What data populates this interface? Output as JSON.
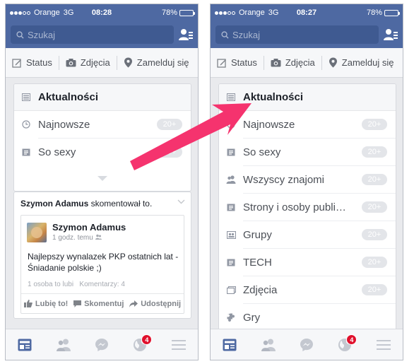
{
  "colors": {
    "header_blue": "#4e69a2",
    "badge_gray": "#e3e5e9",
    "arrow_pink": "#f5336e",
    "notification_red": "#e0102c"
  },
  "left": {
    "status": {
      "carrier": "Orange",
      "network": "3G",
      "time": "08:28",
      "battery": "78%",
      "battery_level": 0.78
    },
    "search": {
      "placeholder": "Szukaj",
      "icon": "search-icon"
    },
    "publisher": {
      "status": "Status",
      "photos": "Zdjęcia",
      "checkin": "Zamelduj się"
    },
    "menu": {
      "header": "Aktualności",
      "items": [
        {
          "label": "Najnowsze",
          "icon": "clock-icon",
          "badge": "20+"
        },
        {
          "label": "So sexy",
          "icon": "list-icon",
          "badge": "20+"
        }
      ]
    },
    "story": {
      "actor": "Szymon Adamus",
      "action": " skomentował to.",
      "post_author": "Szymon Adamus",
      "post_time": "1 godz. temu",
      "post_text": "Najlepszy wynalazek PKP ostatnich lat - Śniadanie polskie ;)",
      "likes": "1 osoba to lubi",
      "comments": "Komentarzy: 4",
      "like_btn": "Lubię to!",
      "comment_btn": "Skomentuj",
      "share_btn": "Udostępnij"
    },
    "tabs": {
      "notifications_badge": "4"
    }
  },
  "right": {
    "status": {
      "carrier": "Orange",
      "network": "3G",
      "time": "08:27",
      "battery": "78%",
      "battery_level": 0.78
    },
    "search": {
      "placeholder": "Szukaj",
      "icon": "search-icon"
    },
    "publisher": {
      "status": "Status",
      "photos": "Zdjęcia",
      "checkin": "Zamelduj się"
    },
    "menu": {
      "header": "Aktualności",
      "items": [
        {
          "label": "Najnowsze",
          "icon": "clock-icon",
          "badge": "20+"
        },
        {
          "label": "So sexy",
          "icon": "list-icon",
          "badge": "20+"
        },
        {
          "label": "Wszyscy znajomi",
          "icon": "friends-icon",
          "badge": "20+"
        },
        {
          "label": "Strony i osoby publi…",
          "icon": "list-icon",
          "badge": "20+"
        },
        {
          "label": "Grupy",
          "icon": "group-icon",
          "badge": "20+"
        },
        {
          "label": "TECH",
          "icon": "list-icon",
          "badge": "20+"
        },
        {
          "label": "Zdjęcia",
          "icon": "photos-icon",
          "badge": "20+"
        },
        {
          "label": "Gry",
          "icon": "games-icon",
          "badge": ""
        }
      ]
    },
    "tabs": {
      "notifications_badge": "4"
    }
  }
}
